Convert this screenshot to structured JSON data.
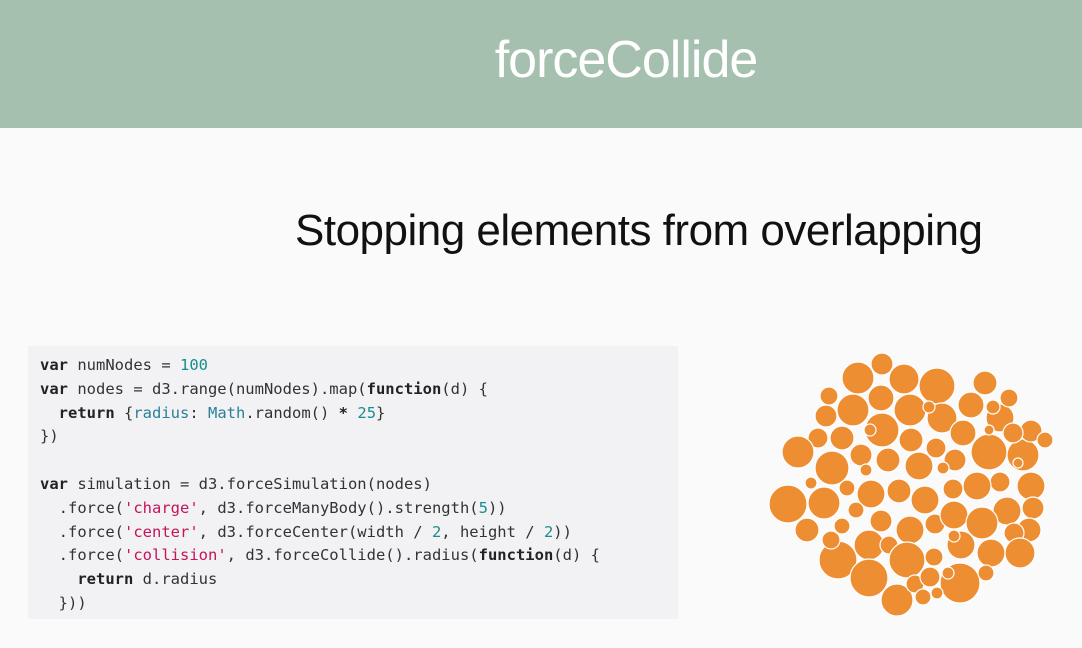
{
  "slide": {
    "title": "forceCollide",
    "subtitle": "Stopping elements from overlapping"
  },
  "code": {
    "lines": [
      [
        {
          "t": "var",
          "k": "kw"
        },
        {
          "t": " numNodes = ",
          "k": "text"
        },
        {
          "t": "100",
          "k": "num"
        }
      ],
      [
        {
          "t": "var",
          "k": "kw"
        },
        {
          "t": " nodes = d3.range(numNodes).map(",
          "k": "text"
        },
        {
          "t": "function",
          "k": "kw"
        },
        {
          "t": "(d) {",
          "k": "text"
        }
      ],
      [
        {
          "t": "  ",
          "k": "text"
        },
        {
          "t": "return",
          "k": "kw"
        },
        {
          "t": " {",
          "k": "text"
        },
        {
          "t": "radius",
          "k": "prop"
        },
        {
          "t": ": ",
          "k": "text"
        },
        {
          "t": "Math",
          "k": "builtin"
        },
        {
          "t": ".random() ",
          "k": "text"
        },
        {
          "t": "*",
          "k": "kw"
        },
        {
          "t": " ",
          "k": "text"
        },
        {
          "t": "25",
          "k": "num"
        },
        {
          "t": "}",
          "k": "text"
        }
      ],
      [
        {
          "t": "})",
          "k": "text"
        }
      ],
      [
        {
          "t": "",
          "k": "text"
        }
      ],
      [
        {
          "t": "var",
          "k": "kw"
        },
        {
          "t": " simulation = d3.forceSimulation(nodes)",
          "k": "text"
        }
      ],
      [
        {
          "t": "  .force(",
          "k": "text"
        },
        {
          "t": "'charge'",
          "k": "str"
        },
        {
          "t": ", d3.forceManyBody().strength(",
          "k": "text"
        },
        {
          "t": "5",
          "k": "num"
        },
        {
          "t": "))",
          "k": "text"
        }
      ],
      [
        {
          "t": "  .force(",
          "k": "text"
        },
        {
          "t": "'center'",
          "k": "str"
        },
        {
          "t": ", d3.forceCenter(width / ",
          "k": "text"
        },
        {
          "t": "2",
          "k": "num"
        },
        {
          "t": ", height / ",
          "k": "text"
        },
        {
          "t": "2",
          "k": "num"
        },
        {
          "t": "))",
          "k": "text"
        }
      ],
      [
        {
          "t": "  .force(",
          "k": "text"
        },
        {
          "t": "'collision'",
          "k": "str"
        },
        {
          "t": ", d3.forceCollide().radius(",
          "k": "text"
        },
        {
          "t": "function",
          "k": "kw"
        },
        {
          "t": "(d) {",
          "k": "text"
        }
      ],
      [
        {
          "t": "    ",
          "k": "text"
        },
        {
          "t": "return",
          "k": "kw"
        },
        {
          "t": " d.radius",
          "k": "text"
        }
      ],
      [
        {
          "t": "  }))",
          "k": "text"
        }
      ]
    ]
  },
  "colors": {
    "header_bg": "#a5c0ae",
    "bubble_fill": "#ee8e33",
    "bubble_stroke": "#ffffff",
    "keyword": "#222222",
    "number": "#1a8d8d",
    "string": "#c4145a",
    "property": "#2a7f99"
  },
  "illustration": {
    "name": "collision-bubble-cluster"
  }
}
